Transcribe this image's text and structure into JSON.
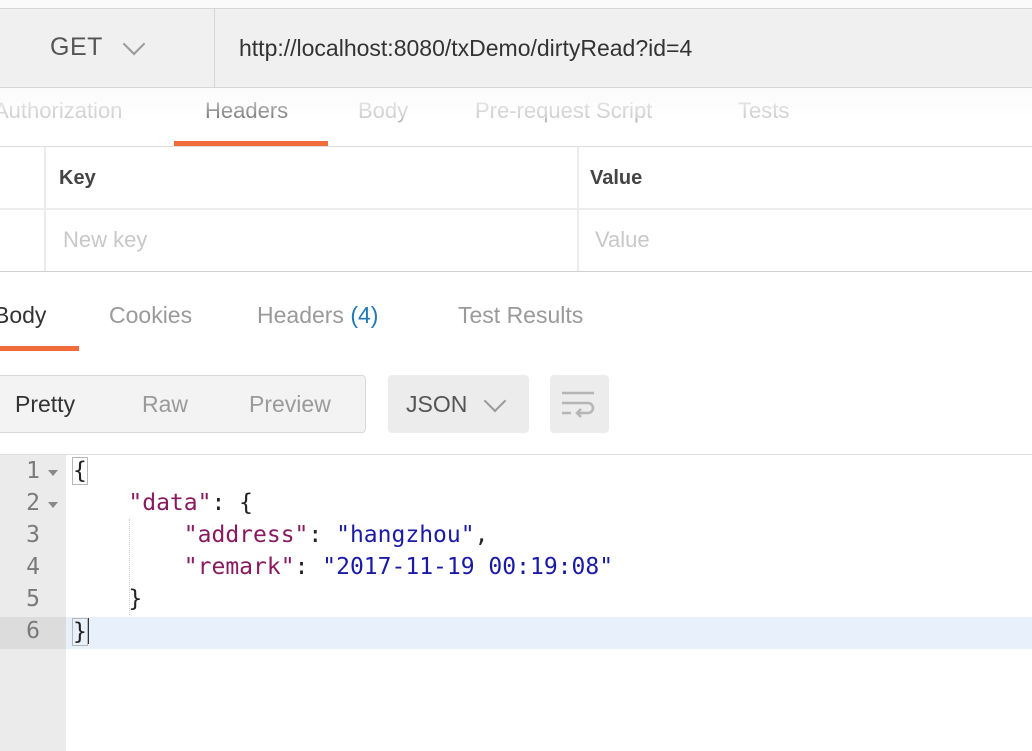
{
  "request": {
    "method": "GET",
    "url": "http://localhost:8080/txDemo/dirtyRead?id=4"
  },
  "request_tabs": [
    "Authorization",
    "Headers",
    "Body",
    "Pre-request Script",
    "Tests"
  ],
  "headers_table": {
    "key_header": "Key",
    "value_header": "Value",
    "key_placeholder": "New key",
    "value_placeholder": "Value"
  },
  "response_tabs": {
    "body": "Body",
    "cookies": "Cookies",
    "headers": "Headers",
    "headers_count": "(4)",
    "test_results": "Test Results"
  },
  "format": {
    "pretty": "Pretty",
    "raw": "Raw",
    "preview": "Preview",
    "language": "JSON"
  },
  "code": {
    "line_numbers": [
      "1",
      "2",
      "3",
      "4",
      "5",
      "6"
    ],
    "open_brace": "{",
    "data_key": "\"data\"",
    "address_key": "\"address\"",
    "address_value": "\"hangzhou\"",
    "remark_key": "\"remark\"",
    "remark_value": "\"2017-11-19 00:19:08\"",
    "close_inner": "}",
    "close_brace": "}"
  },
  "colors": {
    "accent": "#f26b3a",
    "json_key": "#881a5d",
    "json_string": "#1a1aa6",
    "count": "#1f7ab8"
  }
}
